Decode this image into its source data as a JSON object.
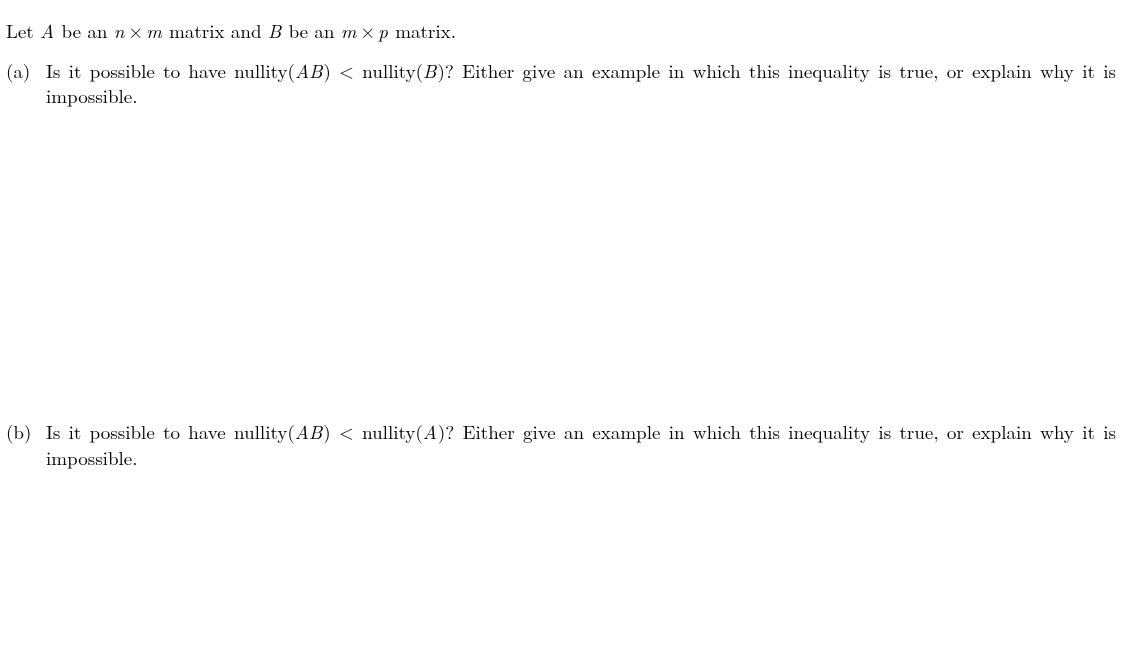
{
  "preamble": {
    "t1": "Let ",
    "A": "A",
    "t2": " be an ",
    "n": "n",
    "times": "×",
    "m": "m",
    "t3": " matrix and ",
    "B": "B",
    "t4": " be an ",
    "m2": "m",
    "times2": "×",
    "p": "p",
    "t5": " matrix."
  },
  "parts": {
    "a": {
      "label": "(a)",
      "t1": "Is it possible to have nullity(",
      "AB": "AB",
      "t2": ") < nullity(",
      "B": "B",
      "t3": ")? Either give an example in which this inequality is true, or explain why it is impossible."
    },
    "b": {
      "label": "(b)",
      "t1": "Is it possible to have nullity(",
      "AB": "AB",
      "t2": ") < nullity(",
      "A": "A",
      "t3": ")? Either give an example in which this inequality is true, or explain why it is impossible."
    }
  }
}
